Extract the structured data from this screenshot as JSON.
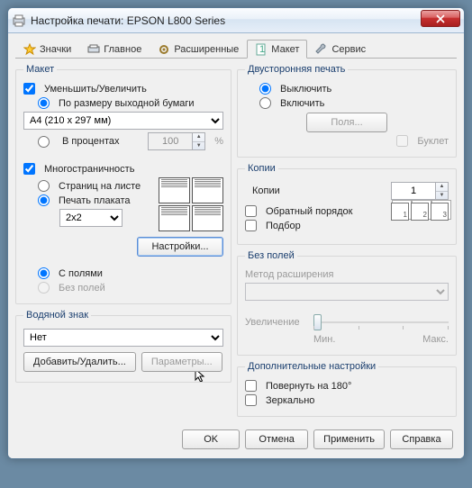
{
  "window": {
    "title": "Настройка печати: EPSON L800 Series"
  },
  "tabs": {
    "badges": "Значки",
    "main": "Главное",
    "advanced": "Расширенные",
    "layout": "Макет",
    "service": "Сервис"
  },
  "layout": {
    "legend": "Макет",
    "reduce_enlarge": "Уменьшить/Увеличить",
    "by_output_paper": "По размеру выходной бумаги",
    "percent": "В процентах",
    "percent_value": "100",
    "percent_suffix": "%",
    "paper": "A4 (210 x 297 мм)",
    "multipage": "Многостраничность",
    "pages_per_sheet": "Страниц на листе",
    "poster": "Печать плаката",
    "poster_value": "2x2",
    "settings_btn": "Настройки...",
    "with_borders": "С полями",
    "borderless": "Без полей"
  },
  "watermark": {
    "legend": "Водяной знак",
    "value": "Нет",
    "add_remove": "Добавить/Удалить...",
    "params": "Параметры..."
  },
  "duplex": {
    "legend": "Двусторонняя печать",
    "off": "Выключить",
    "on": "Включить",
    "margins": "Поля...",
    "booklet": "Буклет"
  },
  "copies": {
    "legend": "Копии",
    "label": "Копии",
    "value": "1",
    "reverse": "Обратный порядок",
    "collate": "Подбор"
  },
  "borderless": {
    "legend": "Без полей",
    "method": "Метод расширения",
    "enlarge": "Увеличение",
    "min": "Мин.",
    "max": "Макс."
  },
  "more": {
    "legend": "Дополнительные настройки",
    "rotate": "Повернуть на  180°",
    "mirror": "Зеркально"
  },
  "footer": {
    "ok": "OK",
    "cancel": "Отмена",
    "apply": "Применить",
    "help": "Справка"
  }
}
